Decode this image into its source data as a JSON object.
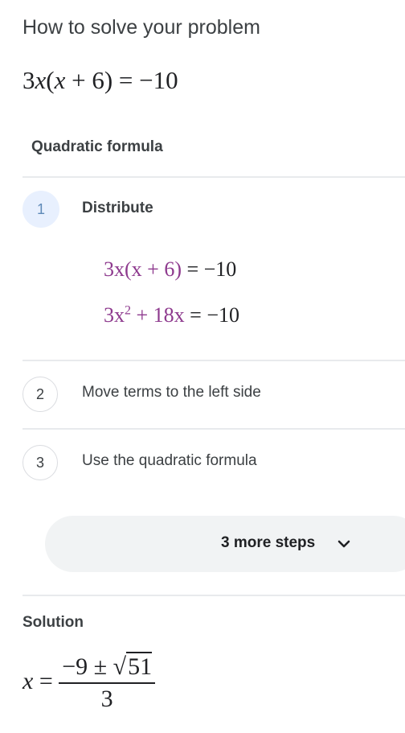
{
  "header": {
    "title": "How to solve your problem"
  },
  "problem": {
    "lhs_coef": "3",
    "lhs_var": "x",
    "lhs_paren_open": "(",
    "lhs_paren_var": "x",
    "lhs_plus": " + 6)",
    "equals": " = ",
    "rhs": "−10"
  },
  "method": {
    "label": "Quadratic formula"
  },
  "steps": [
    {
      "number": "1",
      "label": "Distribute",
      "expanded": true,
      "equations": [
        {
          "left": "3x(x + 6)",
          "right": " = −10"
        },
        {
          "left_a": "3x",
          "left_sup": "2",
          "left_b": " + 18x",
          "right": " = −10"
        }
      ]
    },
    {
      "number": "2",
      "label": "Move terms to the left side",
      "expanded": false
    },
    {
      "number": "3",
      "label": "Use the quadratic formula",
      "expanded": false
    }
  ],
  "more_steps": {
    "label": "3 more steps",
    "icon": "chevron-down-icon"
  },
  "solution": {
    "label": "Solution",
    "var": "x",
    "equals": " = ",
    "numerator_a": "−9 ± ",
    "radical": "√",
    "radicand": "51",
    "denominator": "3"
  }
}
